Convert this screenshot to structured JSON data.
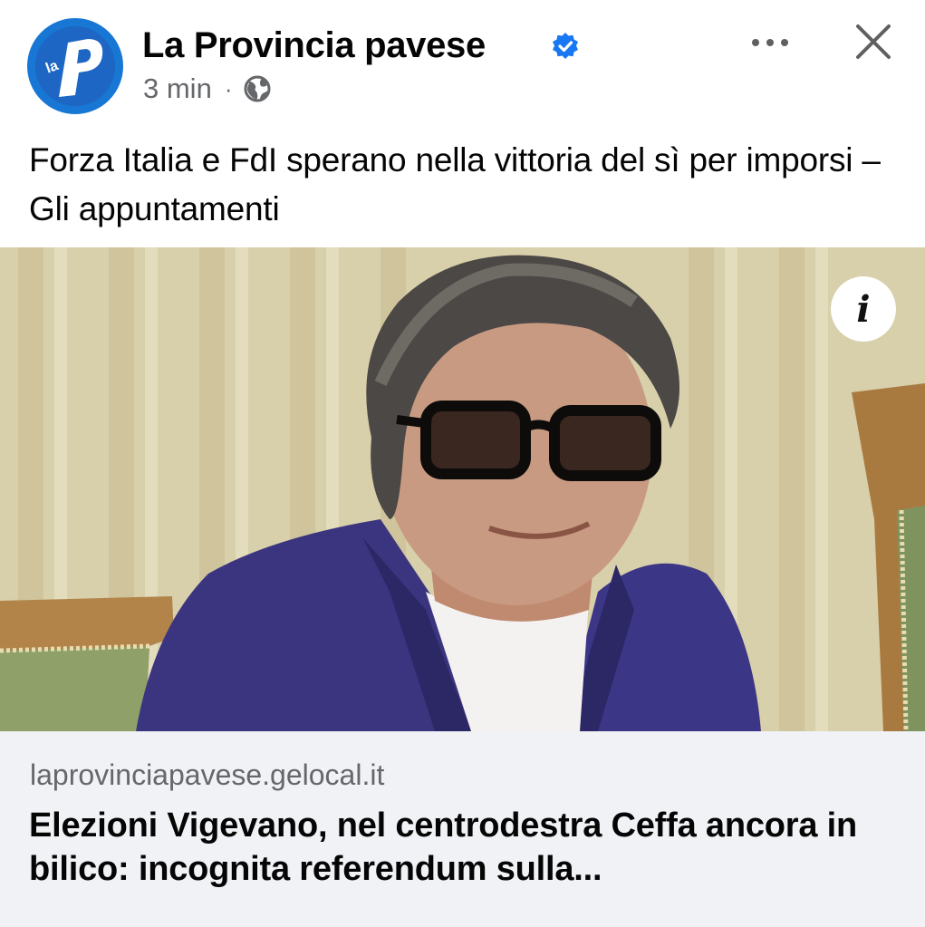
{
  "post": {
    "page_name": "La Provincia pavese",
    "timestamp": "3 min",
    "separator": "·",
    "audience_icon": "globe-icon",
    "verified_icon": "verified-badge-icon",
    "avatar_logo_text": "la",
    "avatar_logo_letter": "P",
    "more_icon": "more-options-icon",
    "close_icon": "close-icon",
    "text": "Forza Italia e FdI sperano nella vittoria del sì per imporsi – Gli appuntamenti"
  },
  "link_preview": {
    "info_icon": "info-icon",
    "info_label": "i",
    "domain": "laprovinciapavese.gelocal.it",
    "headline": "Elezioni Vigevano, nel centrodestra Ceffa ancora in bilico: incognita referendum sulla..."
  },
  "colors": {
    "brand_blue": "#1877f2",
    "text_primary": "#050505",
    "text_secondary": "#65676b",
    "card_background": "#f0f2f5"
  }
}
